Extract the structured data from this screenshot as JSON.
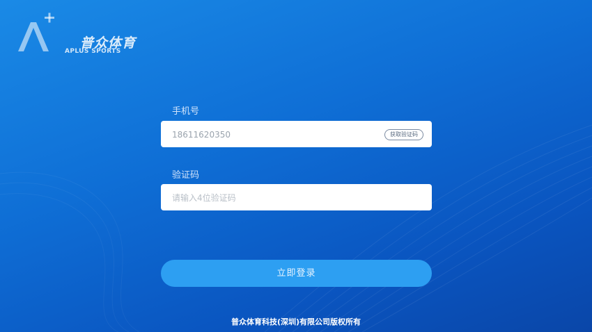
{
  "brand": {
    "name_cn": "普众体育",
    "name_en": "APLUS SPORTS",
    "logo_icon": "a-plus-logo-icon"
  },
  "form": {
    "phone_label": "手机号",
    "phone_value": "18611620350",
    "get_code_label": "获取验证码",
    "code_label": "验证码",
    "code_placeholder": "请输入4位验证码",
    "login_label": "立即登录"
  },
  "footer": {
    "copyright": "普众体育科技(深圳)有限公司版权所有"
  },
  "colors": {
    "background_top": "#1a8ae6",
    "background_bottom": "#0a46a8",
    "button": "#2d9ff2",
    "input_bg": "#ffffff"
  }
}
